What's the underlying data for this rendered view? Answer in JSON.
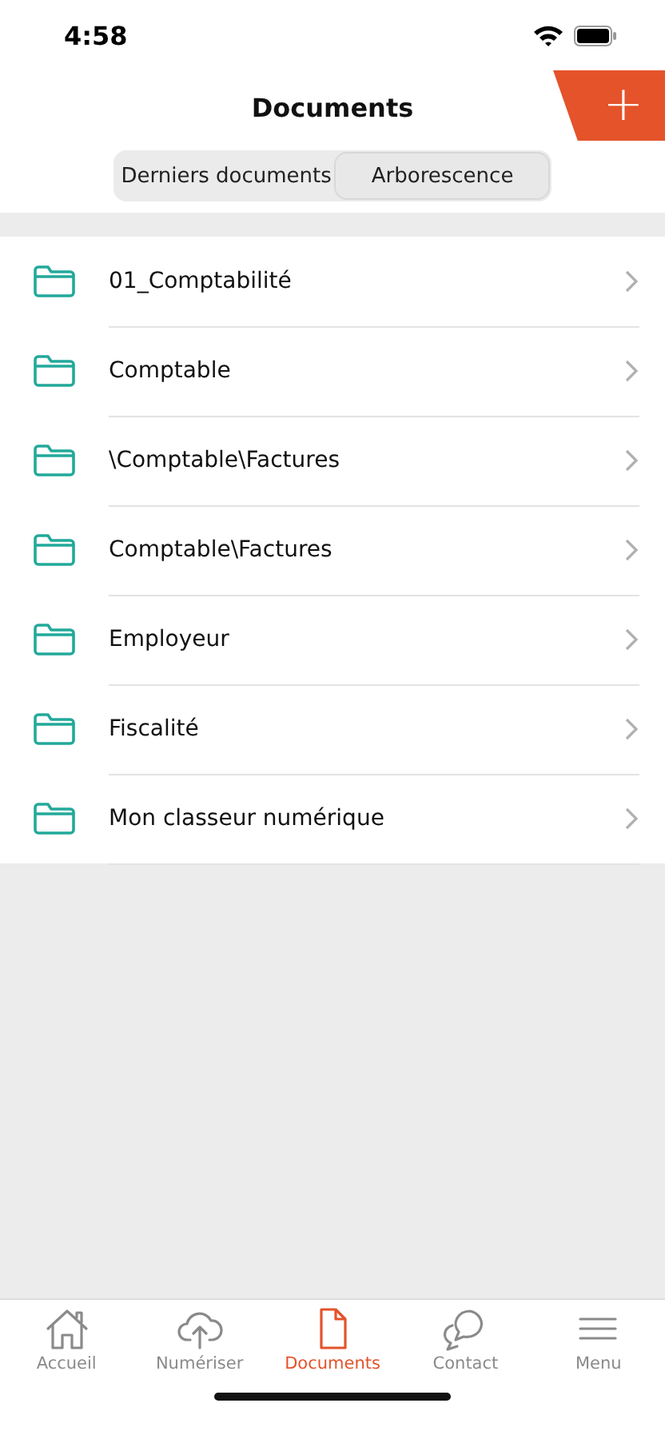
{
  "status_bar": {
    "time": "4:58"
  },
  "header": {
    "title": "Documents",
    "add_button": "+"
  },
  "segments": [
    {
      "label": "Derniers documents",
      "selected": false
    },
    {
      "label": "Arborescence",
      "selected": true
    }
  ],
  "folders": [
    {
      "name": "01_Comptabilité"
    },
    {
      "name": "Comptable"
    },
    {
      "name": "\\Comptable\\Factures"
    },
    {
      "name": "Comptable\\Factures"
    },
    {
      "name": "Employeur"
    },
    {
      "name": "Fiscalité"
    },
    {
      "name": "Mon classeur numérique"
    }
  ],
  "tab_bar": [
    {
      "kind": "home",
      "label": "Accueil",
      "selected": false
    },
    {
      "kind": "upload",
      "label": "Numériser",
      "selected": false
    },
    {
      "kind": "document",
      "label": "Documents",
      "selected": true
    },
    {
      "kind": "chat",
      "label": "Contact",
      "selected": false
    },
    {
      "kind": "menu",
      "label": "Menu",
      "selected": false
    }
  ]
}
